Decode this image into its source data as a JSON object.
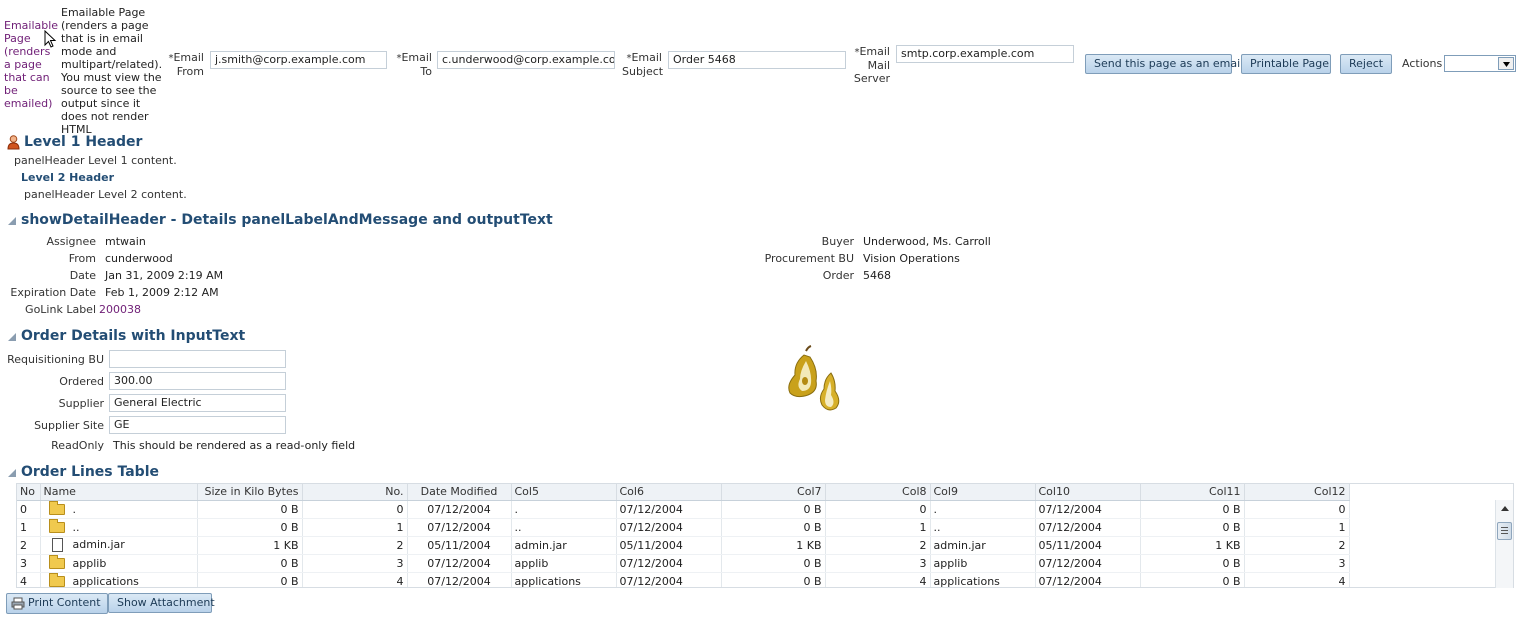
{
  "header": {
    "emailable_link": "Emailable Page (renders a page that can be emailed)",
    "emailable_desc": "Emailable Page (renders a page that is in email mode and multipart/related). You must view the source to see the output since it does not render HTML",
    "required_marker": "*",
    "email_from_label": "Email From",
    "email_from_value": "j.smith@corp.example.com",
    "email_to_label": "Email To",
    "email_to_value": "c.underwood@corp.example.com",
    "email_subject_label": "Email Subject",
    "email_subject_value": "Order 5468",
    "email_server_label": "Email Mail Server",
    "email_server_value": "smtp.corp.example.com",
    "send_button": "Send this page as an email",
    "printable_button": "Printable Page",
    "reject_button": "Reject",
    "actions_label": "Actions",
    "actions_value": ""
  },
  "panel_header": {
    "level1_title": "Level 1 Header",
    "level1_content": "panelHeader Level 1 content.",
    "level2_title": "Level 2 Header",
    "level2_content": "panelHeader Level 2 content."
  },
  "details": {
    "title": "showDetailHeader - Details panelLabelAndMessage and outputText",
    "left": [
      {
        "label": "Assignee",
        "value": "mtwain"
      },
      {
        "label": "From",
        "value": "cunderwood"
      },
      {
        "label": "Date",
        "value": "Jan 31, 2009 2:19 AM"
      },
      {
        "label": "Expiration Date",
        "value": "Feb 1, 2009 2:12 AM"
      },
      {
        "label": "GoLink Label",
        "value": "200038"
      }
    ],
    "right": [
      {
        "label": "Buyer",
        "value": "Underwood, Ms. Carroll"
      },
      {
        "label": "Procurement BU",
        "value": "Vision Operations"
      },
      {
        "label": "Order",
        "value": "5468"
      }
    ]
  },
  "order_details": {
    "title": "Order Details with InputText",
    "fields": [
      {
        "label": "Requisitioning BU",
        "value": ""
      },
      {
        "label": "Ordered",
        "value": "300.00"
      },
      {
        "label": "Supplier",
        "value": "General Electric"
      },
      {
        "label": "Supplier Site",
        "value": "GE"
      }
    ],
    "readonly_label": "ReadOnly",
    "readonly_value": "This should be rendered as a read-only field"
  },
  "table": {
    "title": "Order Lines Table",
    "columns": [
      "No",
      "Name",
      "Size in Kilo Bytes",
      "No.",
      "Date Modified",
      "Col5",
      "Col6",
      "Col7",
      "Col8",
      "Col9",
      "Col10",
      "Col11",
      "Col12"
    ],
    "rows": [
      {
        "icon": "folder",
        "cells": [
          "0",
          ".",
          "0 B",
          "0",
          "07/12/2004",
          ".",
          "07/12/2004",
          "0 B",
          "0",
          ".",
          "07/12/2004",
          "0 B",
          "0"
        ]
      },
      {
        "icon": "folder",
        "cells": [
          "1",
          "..",
          "0 B",
          "1",
          "07/12/2004",
          "..",
          "07/12/2004",
          "0 B",
          "1",
          "..",
          "07/12/2004",
          "0 B",
          "1"
        ]
      },
      {
        "icon": "file",
        "cells": [
          "2",
          "admin.jar",
          "1 KB",
          "2",
          "05/11/2004",
          "admin.jar",
          "05/11/2004",
          "1 KB",
          "2",
          "admin.jar",
          "05/11/2004",
          "1 KB",
          "2"
        ]
      },
      {
        "icon": "folder",
        "cells": [
          "3",
          "applib",
          "0 B",
          "3",
          "07/12/2004",
          "applib",
          "07/12/2004",
          "0 B",
          "3",
          "applib",
          "07/12/2004",
          "0 B",
          "3"
        ]
      },
      {
        "icon": "folder",
        "cells": [
          "4",
          "applications",
          "0 B",
          "4",
          "07/12/2004",
          "applications",
          "07/12/2004",
          "0 B",
          "4",
          "applications",
          "07/12/2004",
          "0 B",
          "4"
        ]
      }
    ]
  },
  "footer": {
    "print_button": "Print Content",
    "attachment_button": "Show Attachment"
  },
  "icons": {
    "user": "user-icon",
    "pear": "pear-image",
    "folder": "folder-icon",
    "file": "file-icon",
    "printer": "printer-icon"
  }
}
